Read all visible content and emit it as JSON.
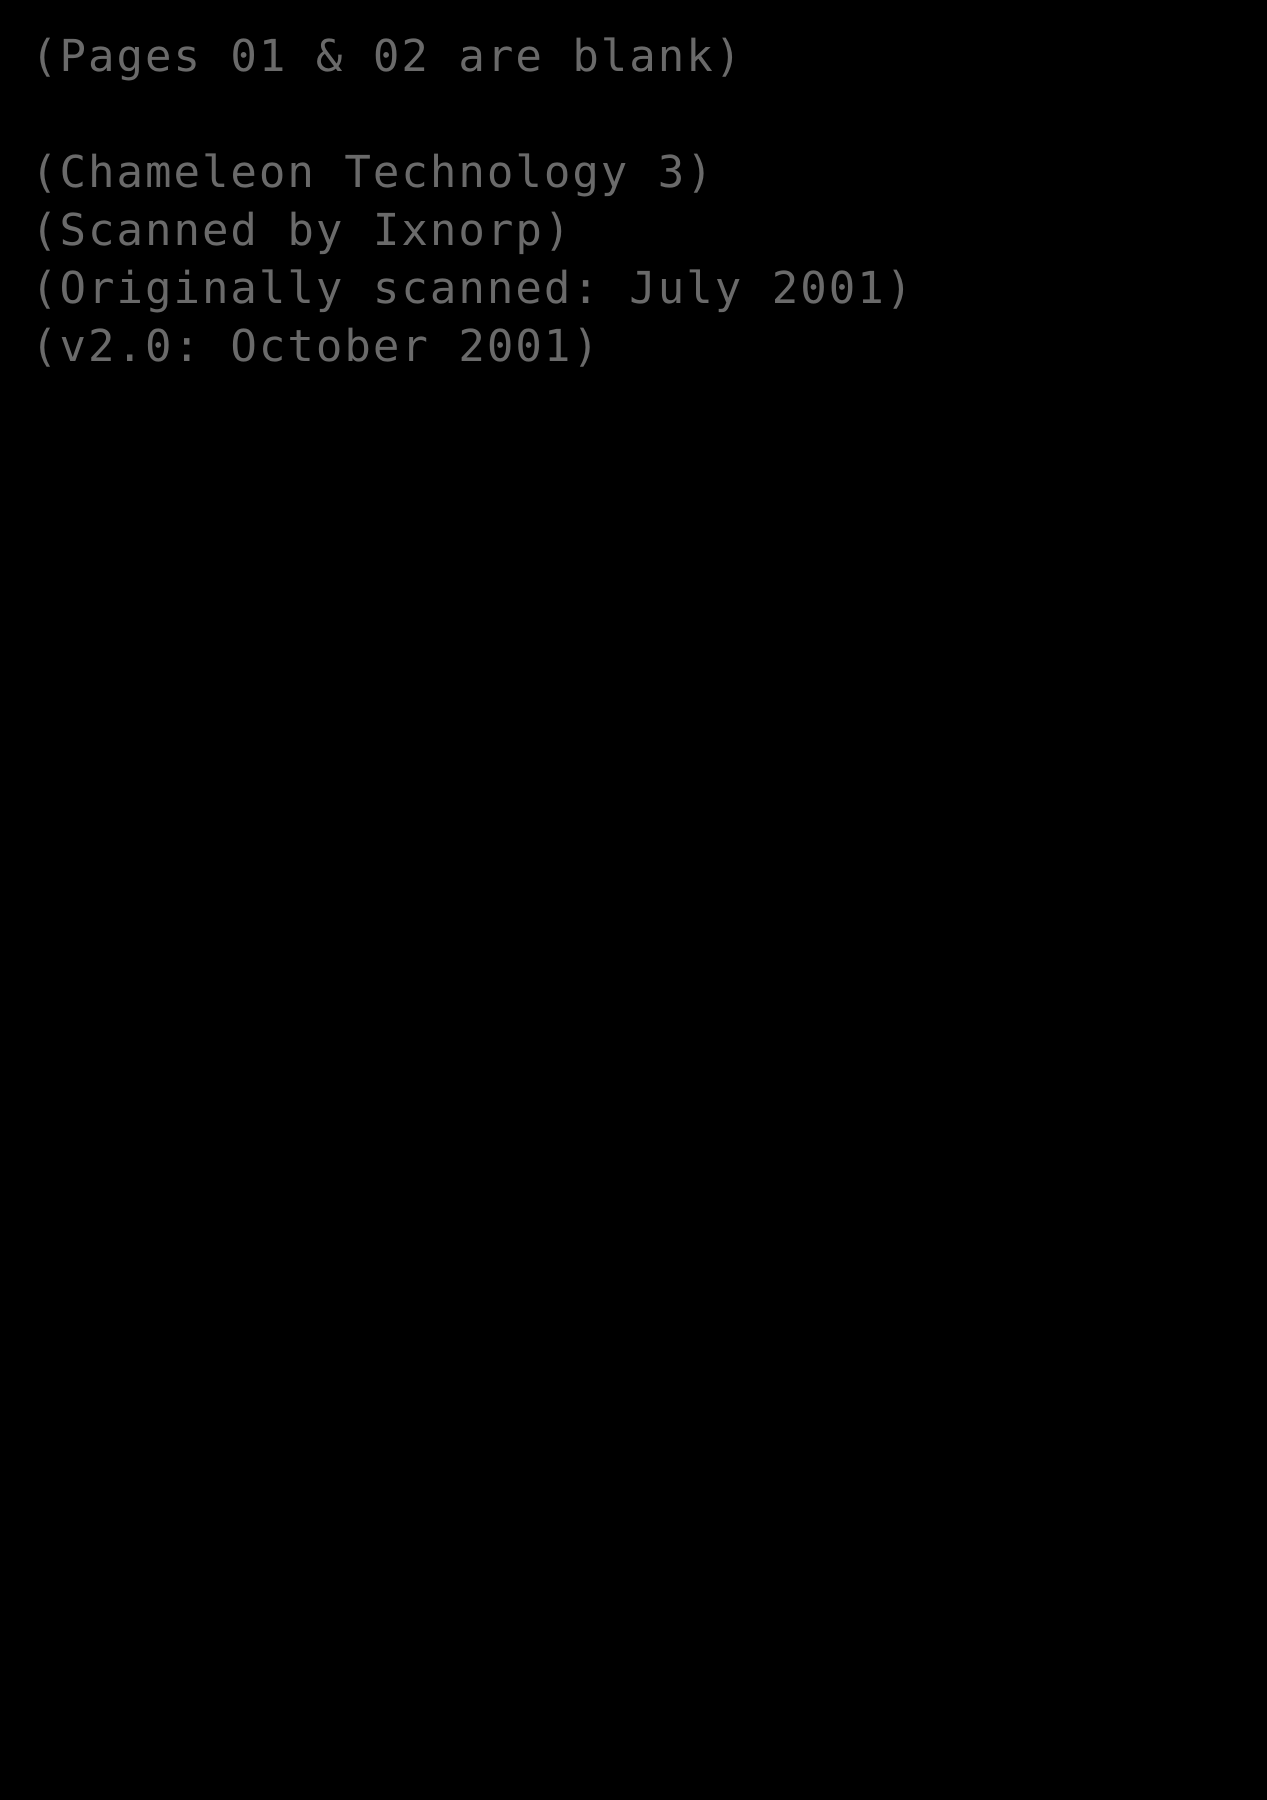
{
  "page": {
    "background_color": "#000000",
    "text_color": "#6a6a6a",
    "kind": "scanned-document-front-matter"
  },
  "notes": {
    "blank_pages_line": "(Pages 01 & 02 are blank)",
    "title_line": "(Chameleon Technology 3)",
    "scanner_line": "(Scanned by Ixnorp)",
    "original_scan_line": "(Originally scanned: July 2001)",
    "version_line": "(v2.0: October 2001)"
  }
}
